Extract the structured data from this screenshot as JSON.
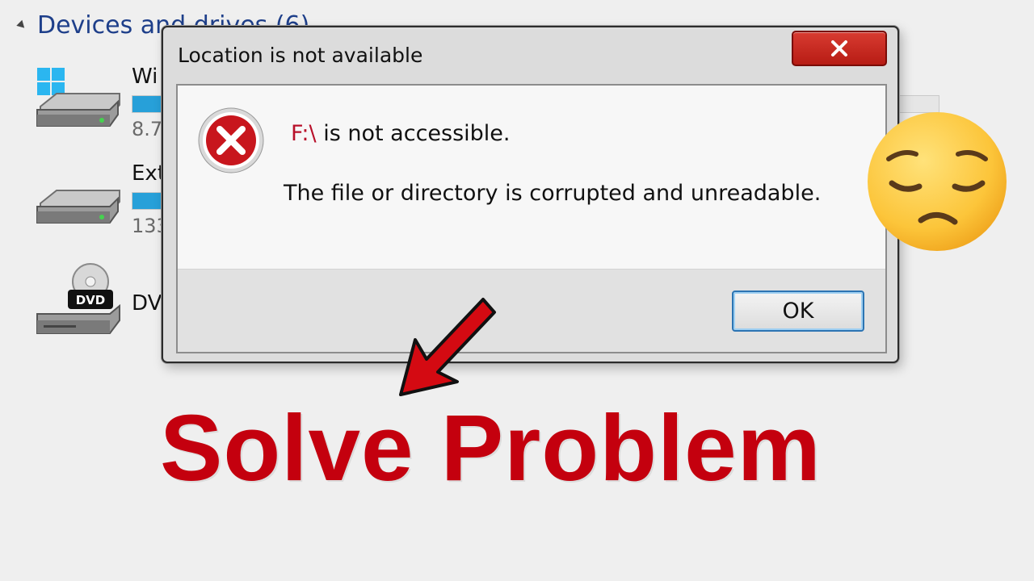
{
  "explorer": {
    "section_header": "Devices and drives (6)",
    "drives": [
      {
        "name": "Wi",
        "info": "8.7",
        "fill_fraction": 0.55,
        "icon": "windows-drive-icon"
      },
      {
        "name": "Ext",
        "info": "133",
        "fill_fraction": 0.4,
        "icon": "external-drive-icon"
      },
      {
        "name": "DV",
        "info": "",
        "icon": "dvd-drive-icon"
      }
    ]
  },
  "dialog": {
    "title": "Location is not available",
    "close_label": "close-icon",
    "icon": "error-icon",
    "message_drive": "F:\\",
    "message_text": " is not accessible.",
    "detail": "The file or directory is corrupted and unreadable.",
    "ok_label": "OK"
  },
  "overlay": {
    "headline": "Solve Problem",
    "emoji": "pensive-face-emoji",
    "arrow": "red-arrow-icon"
  },
  "colors": {
    "headline": "#c4000e",
    "close_button": "#c9271f",
    "explorer_header": "#1e3f8a",
    "drive_bar": "#27a0d9"
  }
}
